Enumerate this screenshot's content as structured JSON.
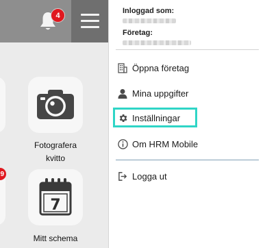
{
  "header": {
    "notification_count": "4"
  },
  "tiles": [
    {
      "label_line1": "Fotografera",
      "label_line2": "kvitto",
      "icon": "camera-icon"
    },
    {
      "label_line1": "Mitt schema",
      "icon": "calendar-icon",
      "calendar_day": "7"
    }
  ],
  "drawer": {
    "logged_in_label": "Inloggad som:",
    "company_label": "Företag:",
    "menu": [
      {
        "label": "Öppna företag",
        "icon": "building-icon"
      },
      {
        "label": "Mina uppgifter",
        "icon": "user-icon"
      },
      {
        "label": "Inställningar",
        "icon": "gear-icon"
      },
      {
        "label": "Om HRM Mobile",
        "icon": "info-icon"
      }
    ],
    "logout_label": "Logga ut"
  },
  "colors": {
    "highlight": "#2fd5c6",
    "badge": "#e0181f",
    "topbar": "#8e8e8e"
  }
}
